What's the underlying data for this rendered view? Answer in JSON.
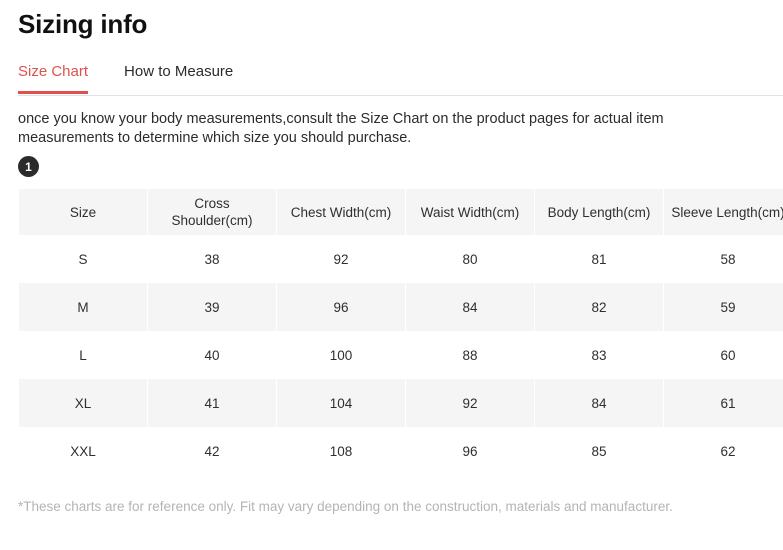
{
  "page": {
    "title": "Sizing info"
  },
  "tabs": [
    {
      "label": "Size Chart",
      "active": true
    },
    {
      "label": "How to Measure",
      "active": false
    }
  ],
  "intro": {
    "text": "once you know your body measurements,consult the Size Chart on the product pages for actual item measurements to determine which size you should purchase."
  },
  "step_badge": {
    "label": "1",
    "icon": "circled-number-badge"
  },
  "size_table": {
    "columns": [
      "Size",
      "Cross Shoulder(cm)",
      "Chest Width(cm)",
      "Waist Width(cm)",
      "Body Length(cm)",
      "Sleeve Length(cm)"
    ],
    "rows": [
      [
        "S",
        "38",
        "92",
        "80",
        "81",
        "58"
      ],
      [
        "M",
        "39",
        "96",
        "84",
        "82",
        "59"
      ],
      [
        "L",
        "40",
        "100",
        "88",
        "83",
        "60"
      ],
      [
        "XL",
        "41",
        "104",
        "92",
        "84",
        "61"
      ],
      [
        "XXL",
        "42",
        "108",
        "96",
        "85",
        "62"
      ]
    ]
  },
  "footnote": {
    "text": "*These charts are for reference only. Fit may vary depending on the construction, materials and manufacturer."
  },
  "colors": {
    "accent": "#e0514f",
    "header_bg": "#f5f5f5",
    "row_alt_bg": "#f5f5f5",
    "text": "#2b2b2b",
    "footnote_text": "#b4b4b4",
    "badge_bg": "#2b2b2b"
  }
}
